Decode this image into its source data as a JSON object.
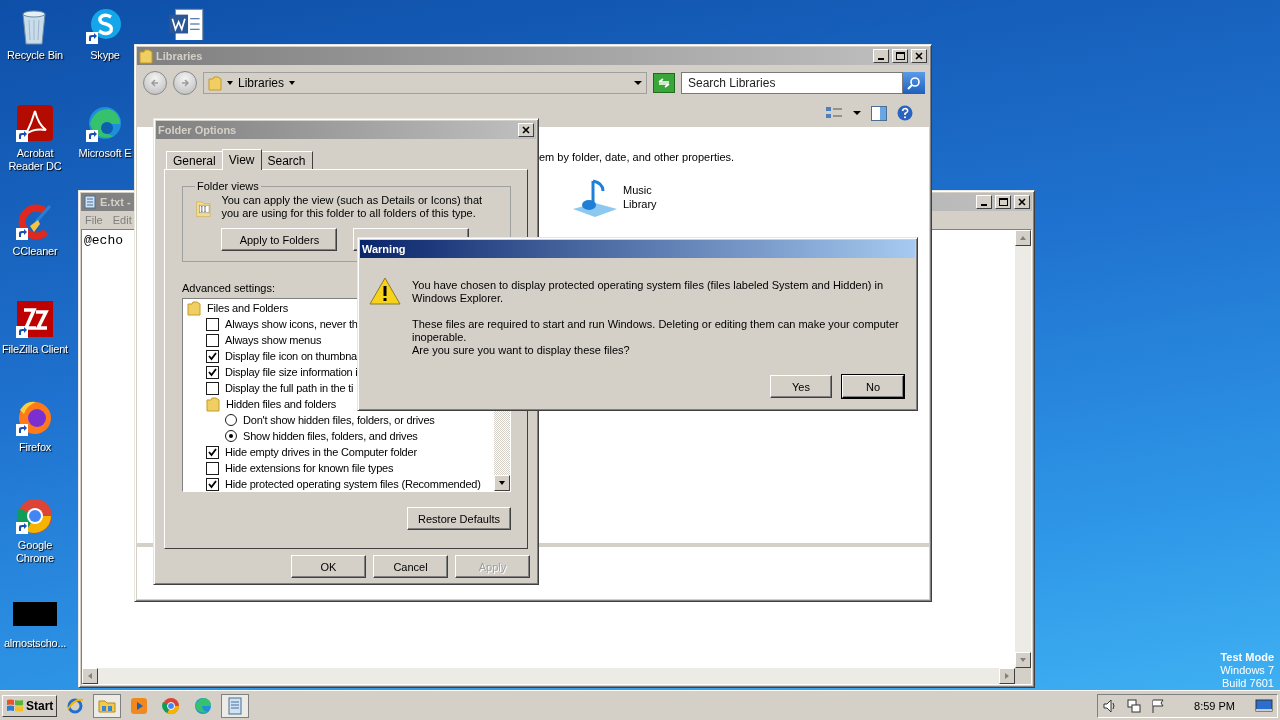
{
  "desktop_icons": [
    [
      {
        "kind": "recycle",
        "label": "Recycle Bin"
      },
      {
        "kind": "acrobat",
        "label": "Acrobat Reader DC"
      },
      {
        "kind": "ccleaner",
        "label": "CCleaner"
      },
      {
        "kind": "filezilla",
        "label": "FileZilla Client"
      },
      {
        "kind": "firefox",
        "label": "Firefox"
      },
      {
        "kind": "chrome",
        "label": "Google Chrome"
      },
      {
        "kind": "black",
        "label": "almostscho..."
      }
    ],
    [
      {
        "kind": "skype",
        "label": "Skype"
      },
      {
        "kind": "edge",
        "label": "Microsoft E"
      }
    ],
    [
      {
        "kind": "word"
      }
    ]
  ],
  "test_mode": [
    "Test Mode",
    "Windows 7",
    "Build 7601"
  ],
  "notepad": {
    "title": "E.txt -",
    "menu": [
      "File",
      "Edit"
    ],
    "text": "@echo"
  },
  "libraries": {
    "title": "Libraries",
    "breadcrumb": "Libraries",
    "search": {
      "placeholder": "Search Libraries"
    },
    "description": "em by folder, date, and other properties.",
    "items": [
      {
        "lines": [
          "Music",
          "Library"
        ]
      }
    ]
  },
  "folder_options": {
    "title": "Folder Options",
    "tabs": [
      {
        "label": "General",
        "selected": false
      },
      {
        "label": "View",
        "selected": true
      },
      {
        "label": "Search",
        "selected": false
      }
    ],
    "group_title": "Folder views",
    "group_text": "You can apply the view (such as Details or Icons) that you are using for this folder to all folders of this type.",
    "apply_button": "Apply to Folders",
    "advanced_label": "Advanced settings:",
    "settings": [
      {
        "kind": "folder",
        "label": "Files and Folders",
        "children": [
          {
            "kind": "checkbox",
            "label": "Always show icons, never th",
            "checked": false
          },
          {
            "kind": "checkbox",
            "label": "Always show menus",
            "checked": false
          },
          {
            "kind": "checkbox",
            "label": "Display file icon on thumbna",
            "checked": true
          },
          {
            "kind": "checkbox",
            "label": "Display file size information i",
            "checked": true
          },
          {
            "kind": "checkbox",
            "label": "Display the full path in the ti",
            "checked": false
          },
          {
            "kind": "folder",
            "label": "Hidden files and folders",
            "children": [
              {
                "kind": "radio",
                "label": "Don't show hidden files, folders, or drives",
                "selected": false
              },
              {
                "kind": "radio",
                "label": "Show hidden files, folders, and drives",
                "selected": true
              }
            ]
          },
          {
            "kind": "checkbox",
            "label": "Hide empty drives in the Computer folder",
            "checked": true
          },
          {
            "kind": "checkbox",
            "label": "Hide extensions for known file types",
            "checked": false
          },
          {
            "kind": "checkbox",
            "label": "Hide protected operating system files (Recommended)",
            "checked": true
          }
        ]
      }
    ],
    "restore_button": "Restore Defaults",
    "buttons": [
      {
        "label": "OK",
        "disabled": false
      },
      {
        "label": "Cancel",
        "disabled": false
      },
      {
        "label": "Apply",
        "disabled": true
      }
    ]
  },
  "warning": {
    "title": "Warning",
    "paragraphs": [
      [
        "You have chosen to display protected operating system files (files labeled System and Hidden) in Windows Explorer."
      ],
      [
        "These files are required to start and run Windows. Deleting or editing them can make your computer inoperable.",
        "Are you sure you want to display these files?"
      ]
    ],
    "buttons": [
      {
        "label": "Yes",
        "default": false
      },
      {
        "label": "No",
        "default": true
      }
    ]
  },
  "taskbar": {
    "start": "Start",
    "apps": [
      {
        "kind": "ie",
        "active": false
      },
      {
        "kind": "explorer",
        "active": true
      },
      {
        "kind": "media",
        "active": false
      },
      {
        "kind": "chrome",
        "active": false
      },
      {
        "kind": "edge",
        "active": false
      },
      {
        "kind": "notepad",
        "active": true
      }
    ],
    "clock": "8:59 PM"
  }
}
